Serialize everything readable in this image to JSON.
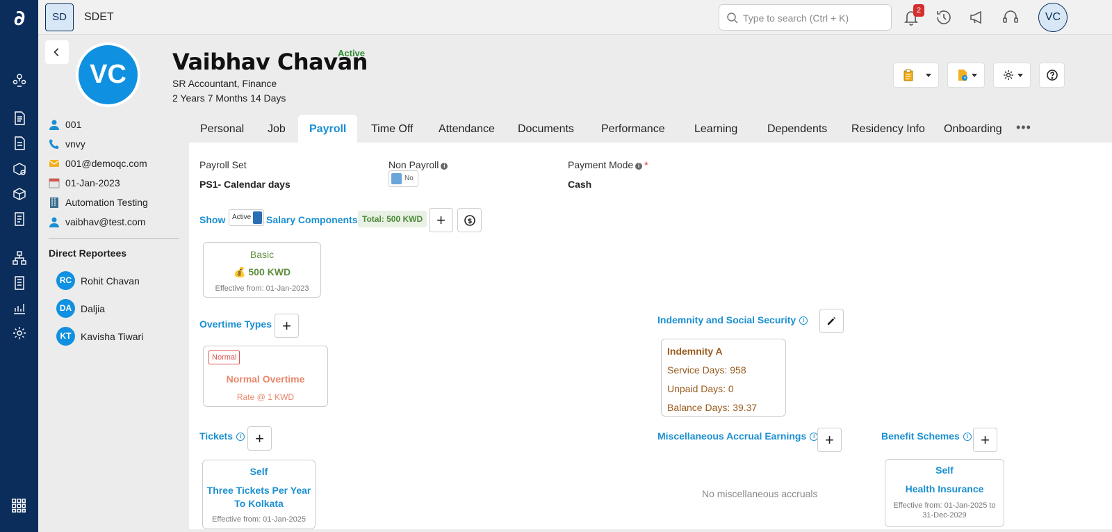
{
  "topbar": {
    "org_code": "SD",
    "org_name": "SDET",
    "search_placeholder": "Type to search (Ctrl + K)",
    "notification_count": "2",
    "user_initials": "VC"
  },
  "profile": {
    "initials": "VC",
    "name": "Vaibhav Chavan",
    "status": "Active",
    "title": "SR Accountant, Finance",
    "tenure": "2 Years 7 Months 14 Days"
  },
  "info": {
    "employee_id": "001",
    "phone": "vnvy",
    "email": "001@demoqc.com",
    "join_date": "01-Jan-2023",
    "department": "Automation Testing",
    "manager": "vaibhav@test.com"
  },
  "reportees": {
    "title": "Direct Reportees",
    "items": [
      {
        "initials": "RC",
        "name": "Rohit Chavan"
      },
      {
        "initials": "DA",
        "name": "Daljia"
      },
      {
        "initials": "KT",
        "name": "Kavisha Tiwari"
      }
    ]
  },
  "tabs": [
    "Personal",
    "Job",
    "Payroll",
    "Time Off",
    "Attendance",
    "Documents",
    "Performance",
    "Learning",
    "Dependents",
    "Residency Info",
    "Onboarding"
  ],
  "tabs_more": "•••",
  "payroll": {
    "payroll_set_label": "Payroll Set",
    "payroll_set_value": "PS1- Calendar days",
    "non_payroll_label": "Non Payroll",
    "non_payroll_value": "No",
    "payment_mode_label": "Payment Mode",
    "payment_mode_value": "Cash",
    "show_label": "Show",
    "active_toggle": "Active",
    "salary_components_title": "Salary Components",
    "total": "Total: 500 KWD",
    "basic": {
      "name": "Basic",
      "amount": "500 KWD",
      "effective": "Effective from: 01-Jan-2023"
    },
    "overtime_title": "Overtime Types",
    "overtime": {
      "tag": "Normal",
      "name": "Normal Overtime",
      "rate": "Rate @ 1 KWD"
    },
    "indemnity_title": "Indemnity and Social Security",
    "indemnity": {
      "name": "Indemnity A",
      "service_days": "Service Days: 958",
      "unpaid_days": "Unpaid Days: 0",
      "balance_days": "Balance Days: 39.37"
    },
    "tickets_title": "Tickets",
    "ticket": {
      "who": "Self",
      "line1": "Three Tickets Per Year",
      "line2": "To Kolkata",
      "effective": "Effective from: 01-Jan-2025"
    },
    "misc_title": "Miscellaneous Accrual Earnings",
    "misc_empty": "No miscellaneous accruals",
    "benefit_title": "Benefit Schemes",
    "benefit": {
      "who": "Self",
      "name": "Health Insurance",
      "effective_line1": "Effective from: 01-Jan-2025 to",
      "effective_line2": "31-Dec-2029"
    }
  },
  "colors": {
    "rail": "#0b2d5b",
    "accent": "#1a8fd1",
    "active_green": "#2e8b2e",
    "salary_green": "#5d8f3c",
    "overtime_salmon": "#e8876a",
    "indemnity_brown": "#9a5b1e"
  }
}
